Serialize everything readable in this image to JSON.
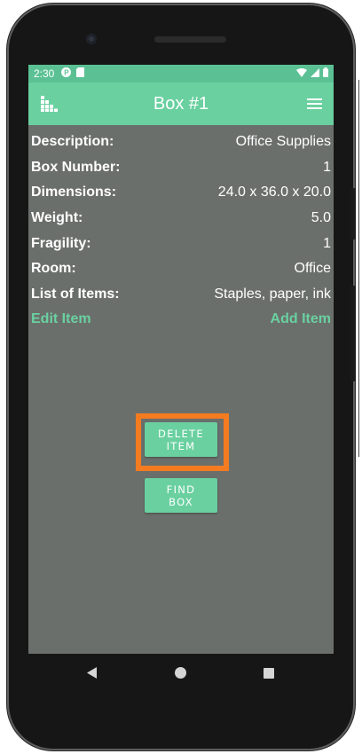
{
  "status_bar": {
    "time": "2:30"
  },
  "app_bar": {
    "title": "Box #1"
  },
  "details": [
    {
      "label": "Description:",
      "value": "Office Supplies"
    },
    {
      "label": "Box Number:",
      "value": "1"
    },
    {
      "label": "Dimensions:",
      "value": "24.0 x 36.0 x 20.0"
    },
    {
      "label": "Weight:",
      "value": "5.0"
    },
    {
      "label": "Fragility:",
      "value": "1"
    },
    {
      "label": "Room:",
      "value": "Office"
    },
    {
      "label": "List of Items:",
      "value": "Staples, paper, ink"
    }
  ],
  "links": {
    "edit": "Edit Item",
    "add": "Add Item"
  },
  "buttons": {
    "delete_line1": "DELETE",
    "delete_line2": "ITEM",
    "find_line1": "FIND",
    "find_line2": "BOX"
  },
  "colors": {
    "accent": "#6ad0a0",
    "status_bar": "#5bc194",
    "background": "#6b6f6c",
    "highlight": "#f47b20"
  },
  "icons": {
    "logo": "stacked-boxes-icon",
    "menu": "hamburger-menu-icon",
    "wifi": "wifi-icon",
    "signal": "cell-signal-icon",
    "battery": "battery-icon"
  }
}
